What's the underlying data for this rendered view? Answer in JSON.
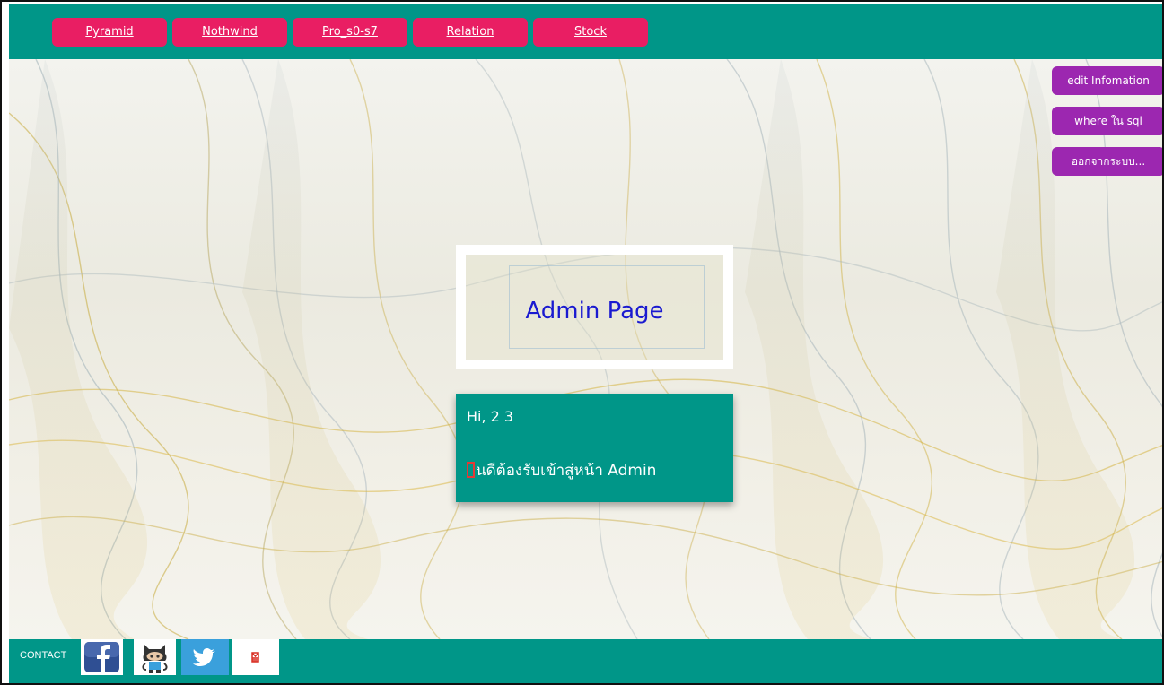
{
  "nav": {
    "items": [
      {
        "label": "Pyramid"
      },
      {
        "label": "Nothwind"
      },
      {
        "label": "Pro_s0-s7"
      },
      {
        "label": "Relation"
      },
      {
        "label": "Stock"
      }
    ]
  },
  "side": {
    "edit_label": "edit Infomation",
    "where_label": "where ใน sql",
    "logout_label": "ออกจากระบบ..."
  },
  "main": {
    "title": "Admin Page",
    "greeting": "Hi, 2 3",
    "welcome": "นดีต้องรับเข้าสู่หน้า Admin"
  },
  "footer": {
    "contact_label": "CONTACT",
    "social": [
      {
        "icon": "facebook-icon"
      },
      {
        "icon": "github-icon"
      },
      {
        "icon": "twitter-icon"
      },
      {
        "icon": "gmail-icon"
      }
    ]
  },
  "colors": {
    "teal": "#009688",
    "pink": "#e91e63",
    "purple": "#9c27b0",
    "title_blue": "#1a1ad0"
  }
}
